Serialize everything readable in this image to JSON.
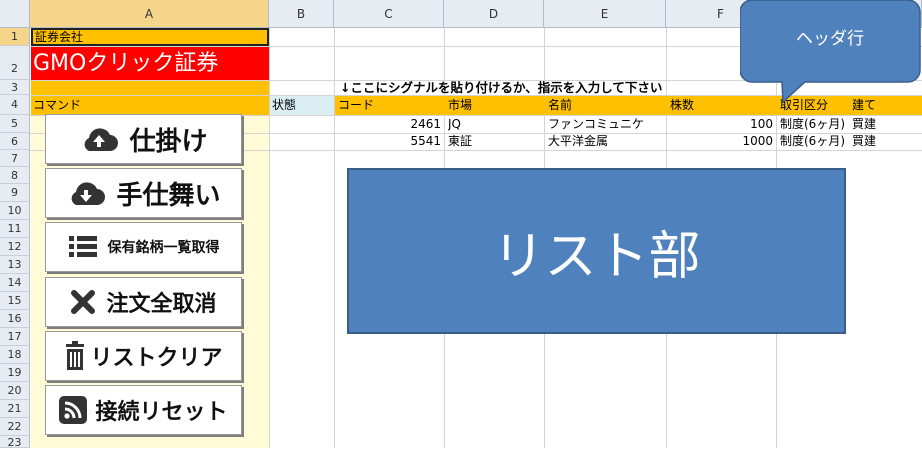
{
  "columns": [
    "A",
    "B",
    "C",
    "D",
    "E",
    "F"
  ],
  "rows": [
    "1",
    "2",
    "3",
    "4",
    "5",
    "6",
    "7",
    "8",
    "9",
    "10",
    "11",
    "12",
    "13",
    "14",
    "15",
    "16",
    "17",
    "18",
    "19",
    "20",
    "21",
    "22",
    "23"
  ],
  "cells": {
    "a1": "証券会社",
    "a2": "GMOクリック証券",
    "c3": "↓ここにシグナルを貼り付けるか、指示を入力して下さい",
    "a4": "コマンド",
    "b4": "状態",
    "c4": "コード",
    "d4": "市場",
    "e4": "名前",
    "f4": "株数",
    "g4": "取引区分",
    "h4": "建て"
  },
  "table_rows": [
    {
      "code": "2461",
      "market": "JQ",
      "name": "ファンコミュニケ",
      "shares": "100",
      "type": "制度(6ヶ月)",
      "side": "買建"
    },
    {
      "code": "5541",
      "market": "東証",
      "name": "大平洋金属",
      "shares": "1000",
      "type": "制度(6ヶ月)",
      "side": "買建"
    }
  ],
  "buttons": {
    "entry": "仕掛け",
    "exit": "手仕舞い",
    "holdings": "保有銘柄一覧取得",
    "cancel_all": "注文全取消",
    "clear_list": "リストクリア",
    "reset_conn": "接続リセット"
  },
  "list_area_label": "リスト部",
  "callout_label": "ヘッダ行",
  "colors": {
    "header_band": "#ffc000",
    "broker_bg": "#ff0000",
    "colA_fill": "#fffbd6",
    "shape_blue": "#4f81bd"
  }
}
